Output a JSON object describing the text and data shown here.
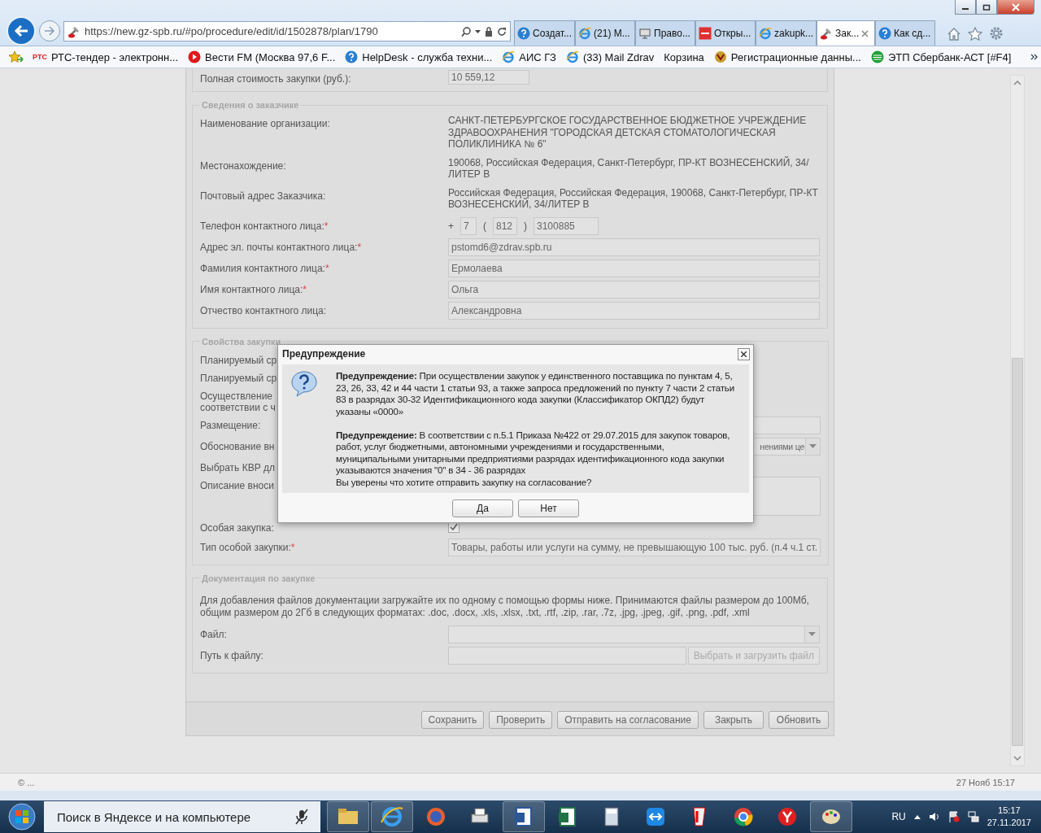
{
  "browser": {
    "address": "https://new.gz-spb.ru/#po/procedure/edit/id/1502878/plan/1790",
    "tabs": [
      {
        "label": "Создат...",
        "kind": "help",
        "selected": false
      },
      {
        "label": "(21) M...",
        "kind": "ie",
        "selected": false
      },
      {
        "label": "Право...",
        "kind": "monitor",
        "selected": false
      },
      {
        "label": "Откры...",
        "kind": "red",
        "selected": false
      },
      {
        "label": "zakupk...",
        "kind": "ie",
        "selected": false
      },
      {
        "label": "Зак...",
        "kind": "tools",
        "selected": true
      },
      {
        "label": "Как сд...",
        "kind": "help",
        "selected": false
      }
    ],
    "favorites": [
      {
        "label": "РТС-тендер - электронн...",
        "kind": "logo",
        "logo": "РТС"
      },
      {
        "label": "Вести FM (Москва 97,6 F...",
        "kind": "play"
      },
      {
        "label": "HelpDesk - служба техни...",
        "kind": "help"
      },
      {
        "label": "АИС ГЗ",
        "kind": "ie"
      },
      {
        "label": "(33) Mail Zdrav",
        "kind": "ie"
      },
      {
        "label": "Корзина",
        "kind": "none"
      },
      {
        "label": "Регистрационные данны...",
        "kind": "emblem"
      },
      {
        "label": "ЭТП Сбербанк-АСТ [#F4]",
        "kind": "sber"
      }
    ]
  },
  "form": {
    "top_row": {
      "label": "Полная стоимость закупки (руб.):",
      "value": "10 559,12"
    },
    "sections": [
      {
        "title": "Сведения о заказчике",
        "rows": [
          {
            "label": "Наименование организации:",
            "control": {
              "kind": "text",
              "value": "САНКТ-ПЕТЕРБУРГСКОЕ ГОСУДАРСТВЕННОЕ БЮДЖЕТНОЕ УЧРЕЖДЕНИЕ ЗДРАВООХРАНЕНИЯ \"ГОРОДСКАЯ ДЕТСКАЯ СТОМАТОЛОГИЧЕСКАЯ ПОЛИКЛИНИКА № 6\""
            }
          },
          {
            "label": "Местонахождение:",
            "control": {
              "kind": "text",
              "value": "190068, Российская Федерация, Санкт-Петербург, ПР-КТ ВОЗНЕСЕНСКИЙ, 34/ЛИТЕР В"
            }
          },
          {
            "label": "Почтовый адрес Заказчика:",
            "control": {
              "kind": "text",
              "value": "Российская Федерация, Российская Федерация, 190068, Санкт-Петербург, ПР-КТ ВОЗНЕСЕНСКИЙ, 34/ЛИТЕР В"
            }
          },
          {
            "label": "Телефон контактного лица:",
            "mark": "*",
            "control": {
              "kind": "phone",
              "plus": "+",
              "country": "7",
              "open": "(",
              "area": "812",
              "close": ")",
              "number": "3100885"
            }
          },
          {
            "label": "Адрес эл. почты контактного лица:",
            "mark": "*",
            "control": {
              "kind": "input",
              "value": "pstomd6@zdrav.spb.ru"
            }
          },
          {
            "label": "Фамилия контактного лица:",
            "mark": "*",
            "control": {
              "kind": "input",
              "value": "Ермолаева"
            }
          },
          {
            "label": "Имя контактного лица:",
            "mark": "*",
            "control": {
              "kind": "input",
              "value": "Ольга"
            }
          },
          {
            "label": "Отчество контактного лица:",
            "control": {
              "kind": "input",
              "value": "Александровна"
            }
          }
        ]
      },
      {
        "title": "Свойства закупки",
        "rows": [
          {
            "label": "Планируемый ср",
            "control": {
              "kind": "none"
            }
          },
          {
            "label": "Планируемый ср",
            "control": {
              "kind": "none"
            }
          },
          {
            "label": "Осуществление\nсоответствии с ч",
            "control": {
              "kind": "none"
            }
          },
          {
            "label": "Размещение:",
            "control": {
              "kind": "input"
            }
          },
          {
            "label": "Обоснование вн",
            "control": {
              "kind": "select",
              "value": "нениями це"
            }
          },
          {
            "label": "Выбрать КВР дл",
            "control": {
              "kind": "none"
            }
          },
          {
            "label": "Описание вноси",
            "control": {
              "kind": "textarea"
            }
          },
          {
            "label": "Особая закупка:",
            "control": {
              "kind": "checkbox",
              "checked": true
            }
          },
          {
            "label": "Тип особой закупки:",
            "mark": "*",
            "control": {
              "kind": "input",
              "value": "Товары, работы или услуги на сумму, не превышающую 100 тыс. руб. (п.4 ч.1 ст."
            }
          }
        ]
      },
      {
        "title": "Документация по закупке",
        "note": "Для добавления файлов документации загружайте их по одному с помощью формы ниже. Принимаются файлы размером до 100Мб, общим размером до 2Гб в следующих форматах: .doc, .docx, .xls, .xlsx, .txt, .rtf, .zip, .rar, .7z, .jpg, .jpeg, .gif, .png, .pdf, .xml",
        "rows": [
          {
            "label": "Файл:",
            "control": {
              "kind": "select"
            }
          },
          {
            "label": "Путь к файлу:",
            "control": {
              "kind": "upload",
              "button": "Выбрать и загрузить файл",
              "disabled": true
            }
          }
        ]
      }
    ],
    "buttons": [
      "Сохранить",
      "Проверить",
      "Отправить на согласование",
      "Закрыть",
      "Обновить"
    ]
  },
  "dialog": {
    "title": "Предупреждение",
    "message": [
      "**Предупреждение:** При осуществлении закупок у единственного поставщика по пунктам 4, 5, 23, 26, 33, 42 и 44 части 1 статьи 93, а также запроса предложений по пункту 7 части 2 статьи 83 в разрядах 30-32 Идентификационного кода закупки (Классификатор ОКПД2) будут указаны «0000»",
      "**Предупреждение:** В соответствии с п.5.1 Приказа №422 от 29.07.2015 для закупок товаров, работ, услуг бюджетными, автономными учреждениями и государственными, муниципальными унитарными предприятиями разрядах идентификационного кода закупки указываются значения \"0\" в 34 - 36 разрядах"
    ],
    "question": "Вы уверены что хотите отправить закупку на согласование?",
    "buttons": [
      "Да",
      "Нет"
    ]
  },
  "status_bar": {
    "left": "© ...",
    "right": "27 Нояб 15:17"
  },
  "taskbar": {
    "search_placeholder": "Поиск в Яндексе и на компьютере",
    "language": "RU",
    "time": "15:17",
    "date": "27.11.2017"
  }
}
